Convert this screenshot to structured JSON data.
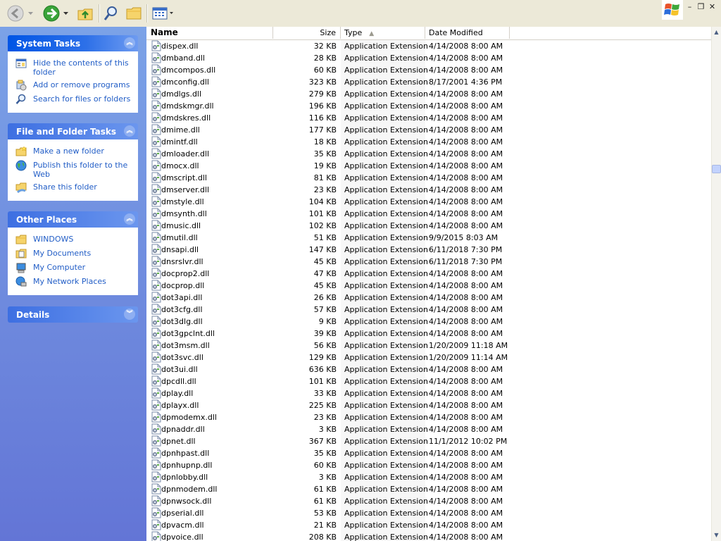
{
  "toolbar": {
    "back_icon": "back-arrow-icon",
    "forward_icon": "forward-arrow-icon",
    "up_icon": "up-folder-icon",
    "search_icon": "search-icon",
    "folders_icon": "folders-icon",
    "views_icon": "views-icon"
  },
  "window": {
    "minimize": "–",
    "restore": "❐",
    "close": "✕"
  },
  "left": {
    "system_tasks": {
      "title": "System Tasks",
      "items": [
        {
          "label": "Hide the contents of this folder",
          "icon": "hide-contents-icon"
        },
        {
          "label": "Add or remove programs",
          "icon": "add-remove-programs-icon"
        },
        {
          "label": "Search for files or folders",
          "icon": "search-icon"
        }
      ]
    },
    "file_folder_tasks": {
      "title": "File and Folder Tasks",
      "items": [
        {
          "label": "Make a new folder",
          "icon": "new-folder-icon"
        },
        {
          "label": "Publish this folder to the Web",
          "icon": "publish-web-icon"
        },
        {
          "label": "Share this folder",
          "icon": "share-folder-icon"
        }
      ]
    },
    "other_places": {
      "title": "Other Places",
      "items": [
        {
          "label": "WINDOWS",
          "icon": "folder-icon"
        },
        {
          "label": "My Documents",
          "icon": "my-documents-icon"
        },
        {
          "label": "My Computer",
          "icon": "my-computer-icon"
        },
        {
          "label": "My Network Places",
          "icon": "network-places-icon"
        }
      ]
    },
    "details": {
      "title": "Details"
    }
  },
  "columns": {
    "name": "Name",
    "size": "Size",
    "type": "Type",
    "date": "Date Modified"
  },
  "files": [
    {
      "name": "dispex.dll",
      "size": "32 KB",
      "type": "Application Extension",
      "date": "4/14/2008 8:00 AM"
    },
    {
      "name": "dmband.dll",
      "size": "28 KB",
      "type": "Application Extension",
      "date": "4/14/2008 8:00 AM"
    },
    {
      "name": "dmcompos.dll",
      "size": "60 KB",
      "type": "Application Extension",
      "date": "4/14/2008 8:00 AM"
    },
    {
      "name": "dmconfig.dll",
      "size": "323 KB",
      "type": "Application Extension",
      "date": "8/17/2001 4:36 PM"
    },
    {
      "name": "dmdlgs.dll",
      "size": "279 KB",
      "type": "Application Extension",
      "date": "4/14/2008 8:00 AM"
    },
    {
      "name": "dmdskmgr.dll",
      "size": "196 KB",
      "type": "Application Extension",
      "date": "4/14/2008 8:00 AM"
    },
    {
      "name": "dmdskres.dll",
      "size": "116 KB",
      "type": "Application Extension",
      "date": "4/14/2008 8:00 AM"
    },
    {
      "name": "dmime.dll",
      "size": "177 KB",
      "type": "Application Extension",
      "date": "4/14/2008 8:00 AM"
    },
    {
      "name": "dmintf.dll",
      "size": "18 KB",
      "type": "Application Extension",
      "date": "4/14/2008 8:00 AM"
    },
    {
      "name": "dmloader.dll",
      "size": "35 KB",
      "type": "Application Extension",
      "date": "4/14/2008 8:00 AM"
    },
    {
      "name": "dmocx.dll",
      "size": "19 KB",
      "type": "Application Extension",
      "date": "4/14/2008 8:00 AM"
    },
    {
      "name": "dmscript.dll",
      "size": "81 KB",
      "type": "Application Extension",
      "date": "4/14/2008 8:00 AM"
    },
    {
      "name": "dmserver.dll",
      "size": "23 KB",
      "type": "Application Extension",
      "date": "4/14/2008 8:00 AM"
    },
    {
      "name": "dmstyle.dll",
      "size": "104 KB",
      "type": "Application Extension",
      "date": "4/14/2008 8:00 AM"
    },
    {
      "name": "dmsynth.dll",
      "size": "101 KB",
      "type": "Application Extension",
      "date": "4/14/2008 8:00 AM"
    },
    {
      "name": "dmusic.dll",
      "size": "102 KB",
      "type": "Application Extension",
      "date": "4/14/2008 8:00 AM"
    },
    {
      "name": "dmutil.dll",
      "size": "51 KB",
      "type": "Application Extension",
      "date": "9/9/2015 8:03 AM"
    },
    {
      "name": "dnsapi.dll",
      "size": "147 KB",
      "type": "Application Extension",
      "date": "6/11/2018 7:30 PM"
    },
    {
      "name": "dnsrslvr.dll",
      "size": "45 KB",
      "type": "Application Extension",
      "date": "6/11/2018 7:30 PM"
    },
    {
      "name": "docprop2.dll",
      "size": "47 KB",
      "type": "Application Extension",
      "date": "4/14/2008 8:00 AM"
    },
    {
      "name": "docprop.dll",
      "size": "45 KB",
      "type": "Application Extension",
      "date": "4/14/2008 8:00 AM"
    },
    {
      "name": "dot3api.dll",
      "size": "26 KB",
      "type": "Application Extension",
      "date": "4/14/2008 8:00 AM"
    },
    {
      "name": "dot3cfg.dll",
      "size": "57 KB",
      "type": "Application Extension",
      "date": "4/14/2008 8:00 AM"
    },
    {
      "name": "dot3dlg.dll",
      "size": "9 KB",
      "type": "Application Extension",
      "date": "4/14/2008 8:00 AM"
    },
    {
      "name": "dot3gpclnt.dll",
      "size": "39 KB",
      "type": "Application Extension",
      "date": "4/14/2008 8:00 AM"
    },
    {
      "name": "dot3msm.dll",
      "size": "56 KB",
      "type": "Application Extension",
      "date": "1/20/2009 11:18 AM"
    },
    {
      "name": "dot3svc.dll",
      "size": "129 KB",
      "type": "Application Extension",
      "date": "1/20/2009 11:14 AM"
    },
    {
      "name": "dot3ui.dll",
      "size": "636 KB",
      "type": "Application Extension",
      "date": "4/14/2008 8:00 AM"
    },
    {
      "name": "dpcdll.dll",
      "size": "101 KB",
      "type": "Application Extension",
      "date": "4/14/2008 8:00 AM"
    },
    {
      "name": "dplay.dll",
      "size": "33 KB",
      "type": "Application Extension",
      "date": "4/14/2008 8:00 AM"
    },
    {
      "name": "dplayx.dll",
      "size": "225 KB",
      "type": "Application Extension",
      "date": "4/14/2008 8:00 AM"
    },
    {
      "name": "dpmodemx.dll",
      "size": "23 KB",
      "type": "Application Extension",
      "date": "4/14/2008 8:00 AM"
    },
    {
      "name": "dpnaddr.dll",
      "size": "3 KB",
      "type": "Application Extension",
      "date": "4/14/2008 8:00 AM"
    },
    {
      "name": "dpnet.dll",
      "size": "367 KB",
      "type": "Application Extension",
      "date": "11/1/2012 10:02 PM"
    },
    {
      "name": "dpnhpast.dll",
      "size": "35 KB",
      "type": "Application Extension",
      "date": "4/14/2008 8:00 AM"
    },
    {
      "name": "dpnhupnp.dll",
      "size": "60 KB",
      "type": "Application Extension",
      "date": "4/14/2008 8:00 AM"
    },
    {
      "name": "dpnlobby.dll",
      "size": "3 KB",
      "type": "Application Extension",
      "date": "4/14/2008 8:00 AM"
    },
    {
      "name": "dpnmodem.dll",
      "size": "61 KB",
      "type": "Application Extension",
      "date": "4/14/2008 8:00 AM"
    },
    {
      "name": "dpnwsock.dll",
      "size": "61 KB",
      "type": "Application Extension",
      "date": "4/14/2008 8:00 AM"
    },
    {
      "name": "dpserial.dll",
      "size": "53 KB",
      "type": "Application Extension",
      "date": "4/14/2008 8:00 AM"
    },
    {
      "name": "dpvacm.dll",
      "size": "21 KB",
      "type": "Application Extension",
      "date": "4/14/2008 8:00 AM"
    },
    {
      "name": "dpvoice.dll",
      "size": "208 KB",
      "type": "Application Extension",
      "date": "4/14/2008 8:00 AM"
    }
  ]
}
